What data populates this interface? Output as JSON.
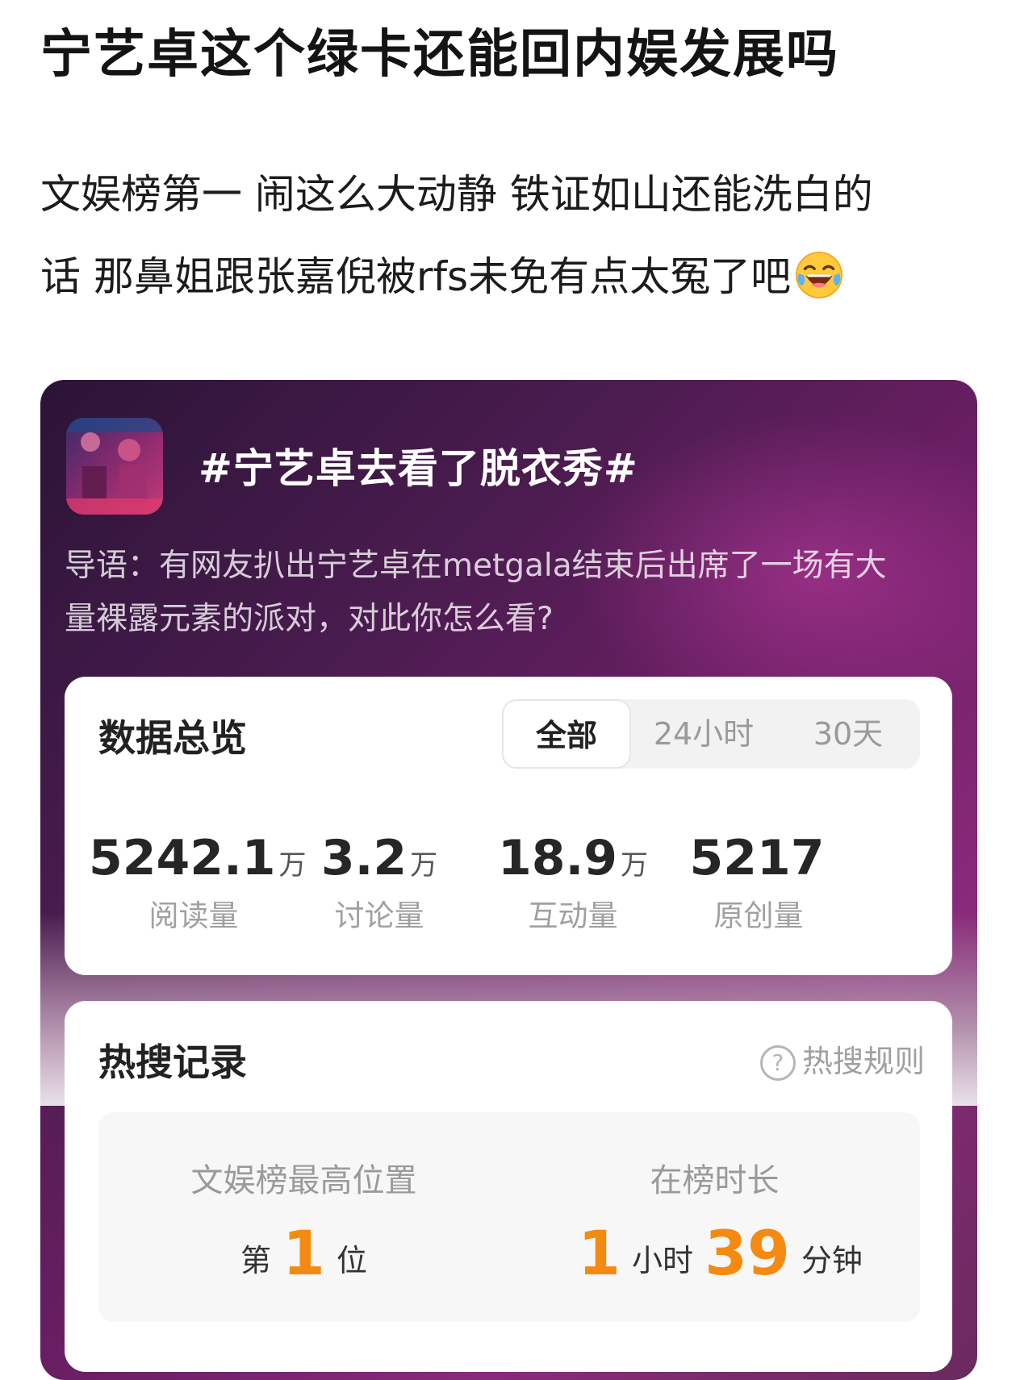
{
  "post": {
    "title": "宁艺卓这个绿卡还能回内娱发展吗",
    "body_line1": "文娱榜第一 闹这么大动静 铁证如山还能洗白的",
    "body_line2": "话 那鼻姐跟张嘉倪被rfs未免有点太冤了吧",
    "emoji": "laughing-crying-emoji"
  },
  "topic": {
    "name": "#宁艺卓去看了脱衣秀#",
    "lead_line1": "导语：有网友扒出宁艺卓在metgala结束后出席了一场有大",
    "lead_line2": "量裸露元素的派对，对此你怎么看?"
  },
  "overview": {
    "title": "数据总览",
    "tabs": [
      "全部",
      "24小时",
      "30天"
    ],
    "active_tab": "全部",
    "stats": [
      {
        "value": "5242.1",
        "unit": "万",
        "label": "阅读量"
      },
      {
        "value": "3.2",
        "unit": "万",
        "label": "讨论量"
      },
      {
        "value": "18.9",
        "unit": "万",
        "label": "互动量"
      },
      {
        "value": "5217",
        "unit": "",
        "label": "原创量"
      }
    ]
  },
  "record": {
    "title": "热搜记录",
    "rules_label": "热搜规则",
    "rank_label": "文娱榜最高位置",
    "rank_prefix": "第",
    "rank_value": "1",
    "rank_suffix": "位",
    "duration_label": "在榜时长",
    "hours": "1",
    "hours_unit": "小时",
    "minutes": "39",
    "minutes_unit": "分钟"
  },
  "colors": {
    "accent_orange": "#f58a12",
    "card_purple": "#6e1f66"
  }
}
